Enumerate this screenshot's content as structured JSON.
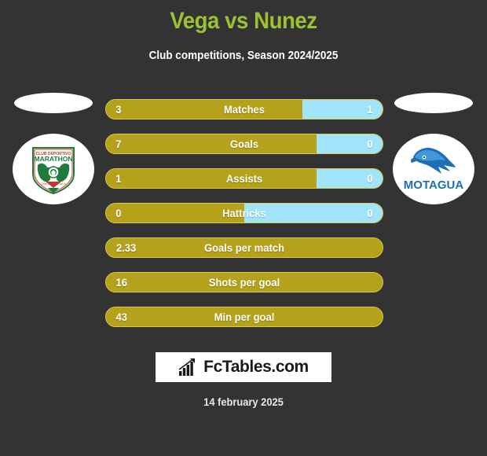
{
  "header": {
    "title": "Vega vs Nunez",
    "subtitle": "Club competitions, Season 2024/2025",
    "title_color": "#9ac233"
  },
  "teams": {
    "home": {
      "logo_name": "marathon-crest",
      "logo_alt": "Marathon"
    },
    "away": {
      "logo_name": "motagua-crest",
      "logo_alt": "MOTAGUA"
    }
  },
  "colors": {
    "background": "#333333",
    "home_bar": "#b5a11a",
    "away_bar": "#a0e5fb",
    "bar_border": "#d9c94f"
  },
  "chart_data": {
    "type": "bar",
    "title": "Vega vs Nunez",
    "subtitle": "Club competitions, Season 2024/2025",
    "categories": [
      "Matches",
      "Goals",
      "Assists",
      "Hattricks",
      "Goals per match",
      "Shots per goal",
      "Min per goal"
    ],
    "series": [
      {
        "name": "Vega",
        "values": [
          "3",
          "7",
          "1",
          "0",
          "2.33",
          "16",
          "43"
        ]
      },
      {
        "name": "Nunez",
        "values": [
          "1",
          "0",
          "0",
          "0",
          null,
          null,
          null
        ]
      }
    ],
    "legend": "none"
  },
  "stats": [
    {
      "label": "Matches",
      "home": "3",
      "away": "1",
      "home_pct": 71,
      "split": true
    },
    {
      "label": "Goals",
      "home": "7",
      "away": "0",
      "home_pct": 76,
      "split": true
    },
    {
      "label": "Assists",
      "home": "1",
      "away": "0",
      "home_pct": 76,
      "split": true
    },
    {
      "label": "Hattricks",
      "home": "0",
      "away": "0",
      "home_pct": 50,
      "split": true
    },
    {
      "label": "Goals per match",
      "home": "2.33",
      "away": "",
      "home_pct": 100,
      "split": false
    },
    {
      "label": "Shots per goal",
      "home": "16",
      "away": "",
      "home_pct": 100,
      "split": false
    },
    {
      "label": "Min per goal",
      "home": "43",
      "away": "",
      "home_pct": 100,
      "split": false
    }
  ],
  "footer": {
    "brand": "FcTables.com",
    "brand_icon": "bar-chart-growth-icon",
    "date": "14 february 2025"
  }
}
